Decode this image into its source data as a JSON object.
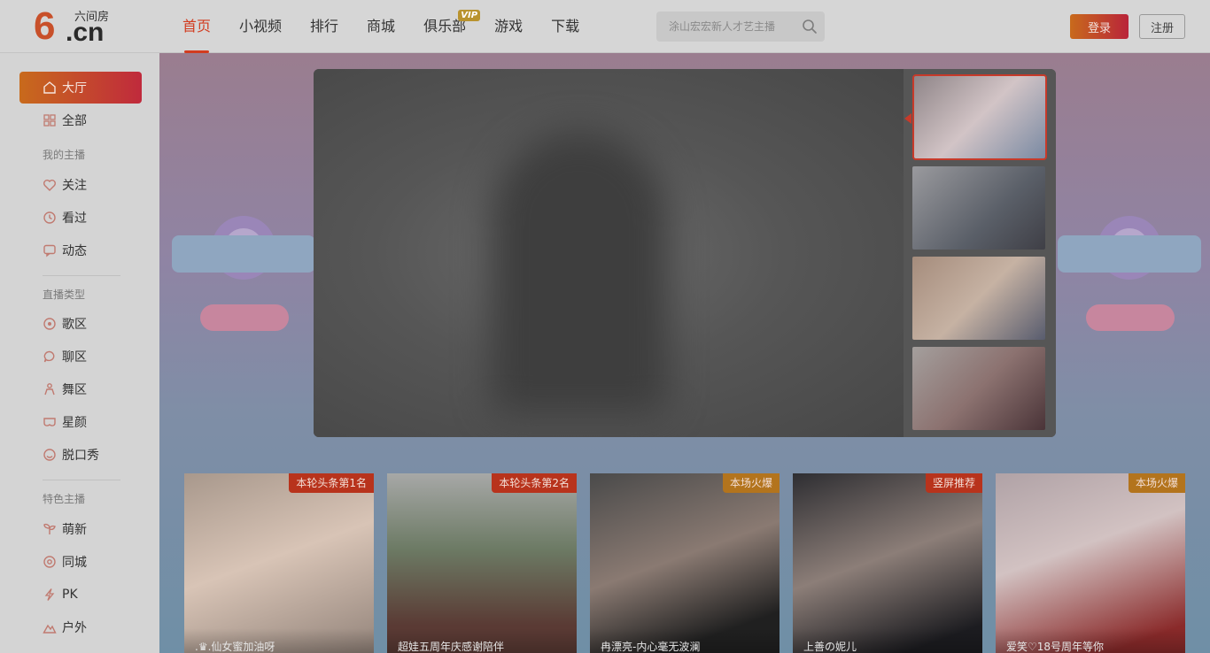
{
  "logo": {
    "mark": "6",
    "domain": ".cn",
    "brand": "六间房"
  },
  "nav": {
    "items": [
      {
        "label": "首页",
        "active": true
      },
      {
        "label": "小视频"
      },
      {
        "label": "排行"
      },
      {
        "label": "商城"
      },
      {
        "label": "俱乐部",
        "badge": "VIP"
      },
      {
        "label": "游戏"
      },
      {
        "label": "下载"
      }
    ]
  },
  "search": {
    "placeholder": "涂山宏宏新人才艺主播",
    "icon": "search-icon"
  },
  "auth": {
    "login": "登录",
    "register": "注册"
  },
  "sidebar": {
    "items": {
      "hall": "大厅",
      "all": "全部",
      "follow": "关注",
      "viewed": "看过",
      "moments": "动态",
      "song": "歌区",
      "chat": "聊区",
      "dance": "舞区",
      "face": "星颜",
      "talk": "脱口秀",
      "newbie": "萌新",
      "local": "同城",
      "pk": "PK",
      "outdoor": "户外"
    },
    "heads": {
      "mine": "我的主播",
      "types": "直播类型",
      "special": "特色主播"
    }
  },
  "cards": [
    {
      "tag": "本轮头条第1名",
      "name": ".♛.仙女蜜加油呀"
    },
    {
      "tag": "本轮头条第2名",
      "name": "超娃五周年庆感谢陪伴"
    },
    {
      "tag": "本场火爆",
      "name": "冉漂亮-内心毫无波澜"
    },
    {
      "tag": "竖屏推荐",
      "name": "上善の妮儿"
    },
    {
      "tag": "本场火爆",
      "name": "爱笑♡18号周年等你"
    }
  ],
  "colors": {
    "accent": "#d23c20",
    "login_gradient": [
      "#c86a1c",
      "#b9243a"
    ]
  }
}
